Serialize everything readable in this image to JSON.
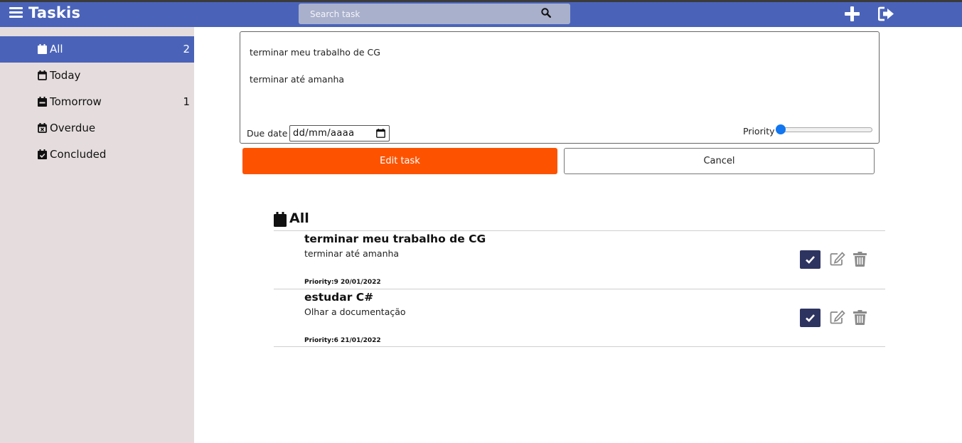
{
  "header": {
    "app_title": "Taskis",
    "search_placeholder": "Search task",
    "icons": [
      "menu-icon",
      "search-icon",
      "plus-icon",
      "logout-icon"
    ],
    "color": "#4a63b9"
  },
  "sidebar": {
    "items": [
      {
        "label": "All",
        "count": "2",
        "icon": "calendar-icon",
        "active": true
      },
      {
        "label": "Today",
        "count": "",
        "icon": "calendar-outline-icon",
        "active": false
      },
      {
        "label": "Tomorrow",
        "count": "1",
        "icon": "calendar-minus-icon",
        "active": false
      },
      {
        "label": "Overdue",
        "count": "",
        "icon": "calendar-x-icon",
        "active": false
      },
      {
        "label": "Concluded",
        "count": "",
        "icon": "calendar-check-icon",
        "active": false
      }
    ]
  },
  "form": {
    "title_value": "terminar meu trabalho de CG",
    "description_value": "terminar até amanha",
    "due_label": "Due date",
    "date_value": "dd/mm/aaaa",
    "priority_label": "Priority",
    "priority_level": 0,
    "edit_label": "Edit task",
    "cancel_label": "Cancel"
  },
  "list": {
    "title": "All",
    "tasks": [
      {
        "title": "terminar meu trabalho de CG",
        "description": "terminar até amanha",
        "meta": "Priority:9  20/01/2022"
      },
      {
        "title": "estudar C#",
        "description": "Olhar a documentação",
        "meta": "Priority:6  21/01/2022"
      }
    ]
  },
  "colors": {
    "accent": "#4a63b9",
    "edit_button": "#fd5300",
    "check_button": "#2e3460",
    "sidebar_bg": "#e5dddd"
  }
}
